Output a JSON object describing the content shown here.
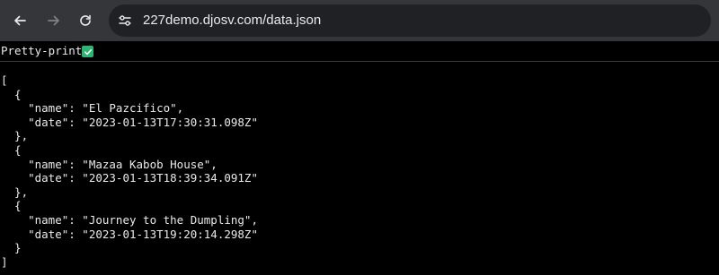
{
  "browser": {
    "back_icon": "arrow-left-icon",
    "forward_icon": "arrow-right-icon",
    "reload_icon": "reload-icon",
    "site_info_icon": "tune-icon",
    "url": "227demo.djosv.com/data.json"
  },
  "pretty_print": {
    "label": "Pretty-print",
    "checked": true,
    "check_color": "#2bb673"
  },
  "json_lines": [
    "[",
    "  {",
    "    \"name\": \"El Pazcifico\",",
    "    \"date\": \"2023-01-13T17:30:31.098Z\"",
    "  },",
    "  {",
    "    \"name\": \"Mazaa Kabob House\",",
    "    \"date\": \"2023-01-13T18:39:34.091Z\"",
    "  },",
    "  {",
    "    \"name\": \"Journey to the Dumpling\",",
    "    \"date\": \"2023-01-13T19:20:14.298Z\"",
    "  }",
    "]"
  ]
}
